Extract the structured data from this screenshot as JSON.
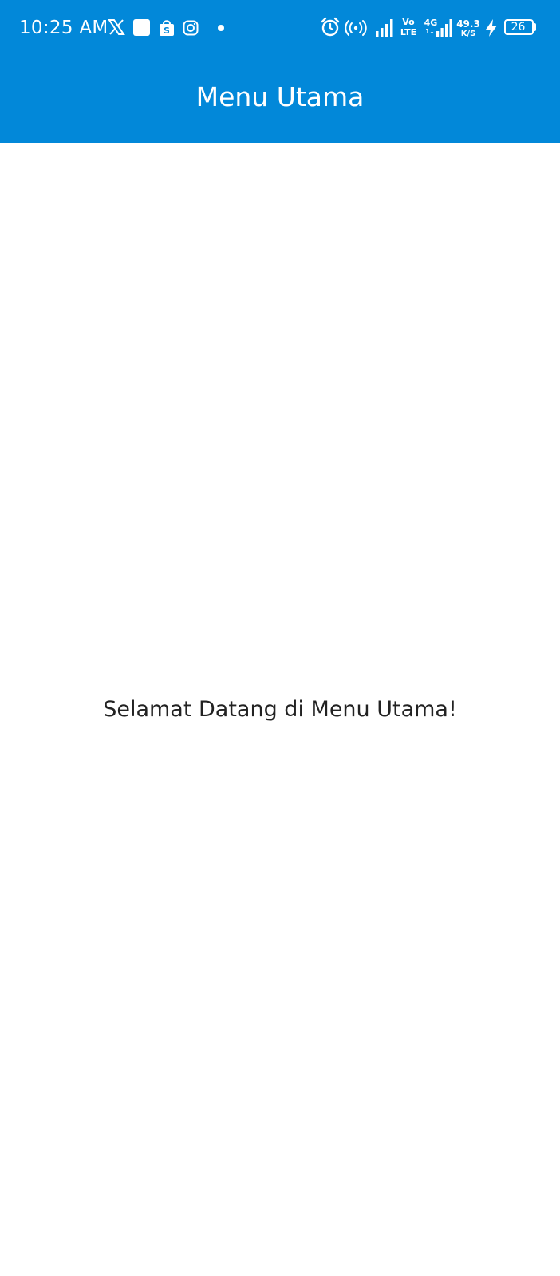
{
  "status_bar": {
    "time": "10:25 AM",
    "notification_icons": [
      "x-twitter-icon",
      "app-square-icon",
      "shopee-bag-icon",
      "instagram-icon",
      "more-notifications-dot-icon"
    ],
    "volte_top": "Vo",
    "volte_bottom": "LTE",
    "network_type": "4G",
    "network_sub": "1↓",
    "speed_value": "49.3",
    "speed_unit": "K/S",
    "battery_level": "26",
    "battery_fraction": 0.26,
    "charging": true
  },
  "app_bar": {
    "title": "Menu Utama",
    "color": "#0288D9"
  },
  "body": {
    "welcome_text": "Selamat Datang di Menu Utama!",
    "background": "#FFFFFF",
    "text_color": "#222222"
  }
}
